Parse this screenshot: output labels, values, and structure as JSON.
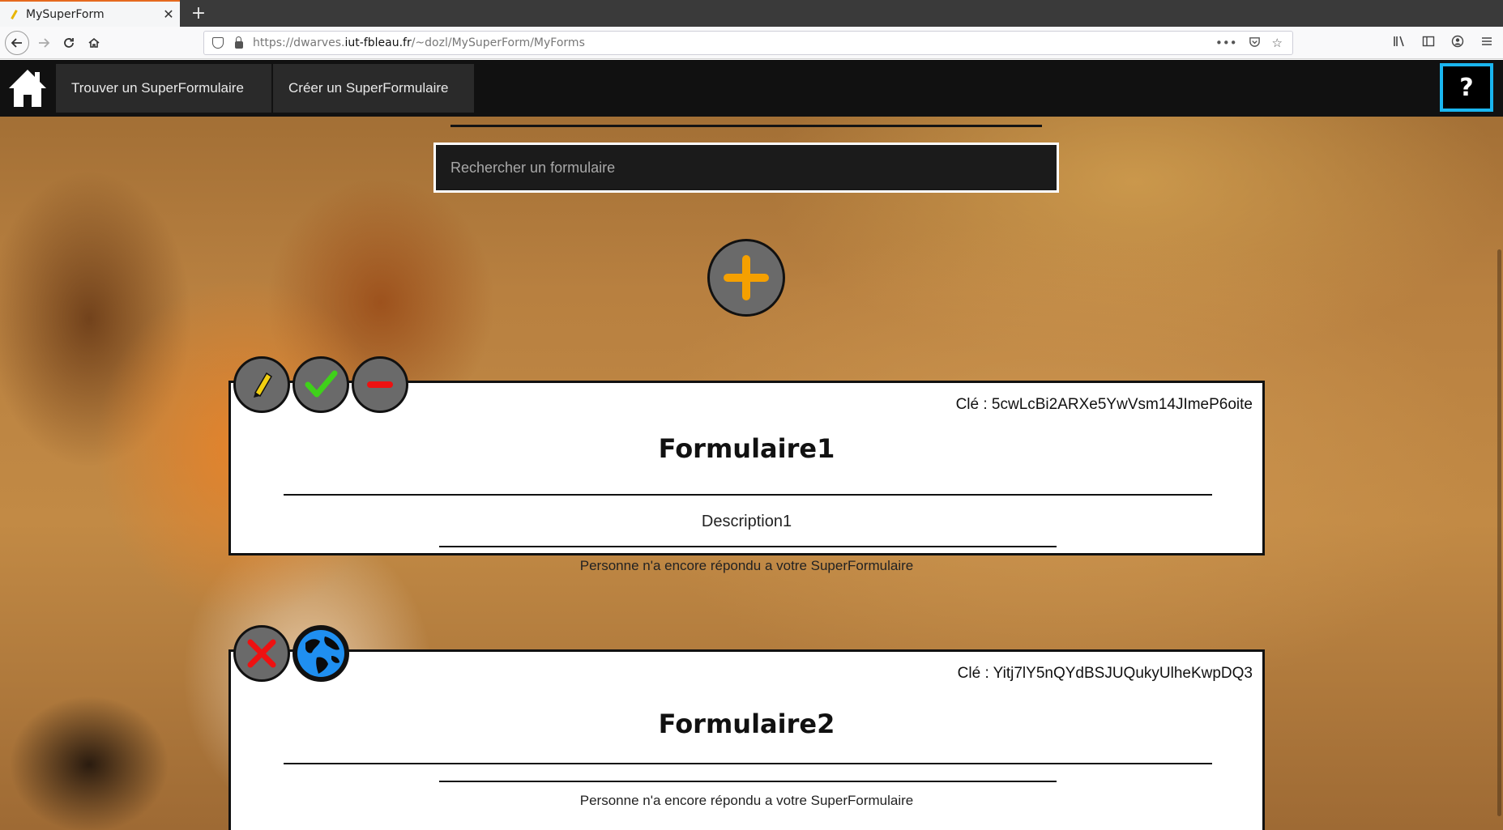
{
  "browser": {
    "tab_title": "MySuperForm",
    "tab_close": "✕",
    "new_tab": "+",
    "url_prefix": "https://dwarves.",
    "url_host": "iut-fbleau.fr",
    "url_path": "/~dozl/MySuperForm/MyForms"
  },
  "header": {
    "nav_find_label": "Trouver un SuperFormulaire",
    "nav_create_label": "Créer un SuperFormulaire",
    "help_label": "?"
  },
  "search": {
    "placeholder": "Rechercher un formulaire"
  },
  "forms": [
    {
      "key": "Clé : 5cwLcBi2ARXe5YwVsm14JImeP6oite",
      "title": "Formulaire1",
      "description": "Description1",
      "status": "Personne n'a encore répondu a votre SuperFormulaire"
    },
    {
      "key": "Clé : Yitj7lY5nQYdBSJUQukyUlheKwpDQ3",
      "title": "Formulaire2",
      "description": "",
      "status": "Personne n'a encore répondu a votre SuperFormulaire"
    }
  ],
  "colors": {
    "accent_orange": "#f5a000",
    "help_border": "#1ab6f0",
    "check_green": "#3fd11a",
    "minus_red": "#ee1111",
    "globe_blue": "#1f8ff0"
  }
}
